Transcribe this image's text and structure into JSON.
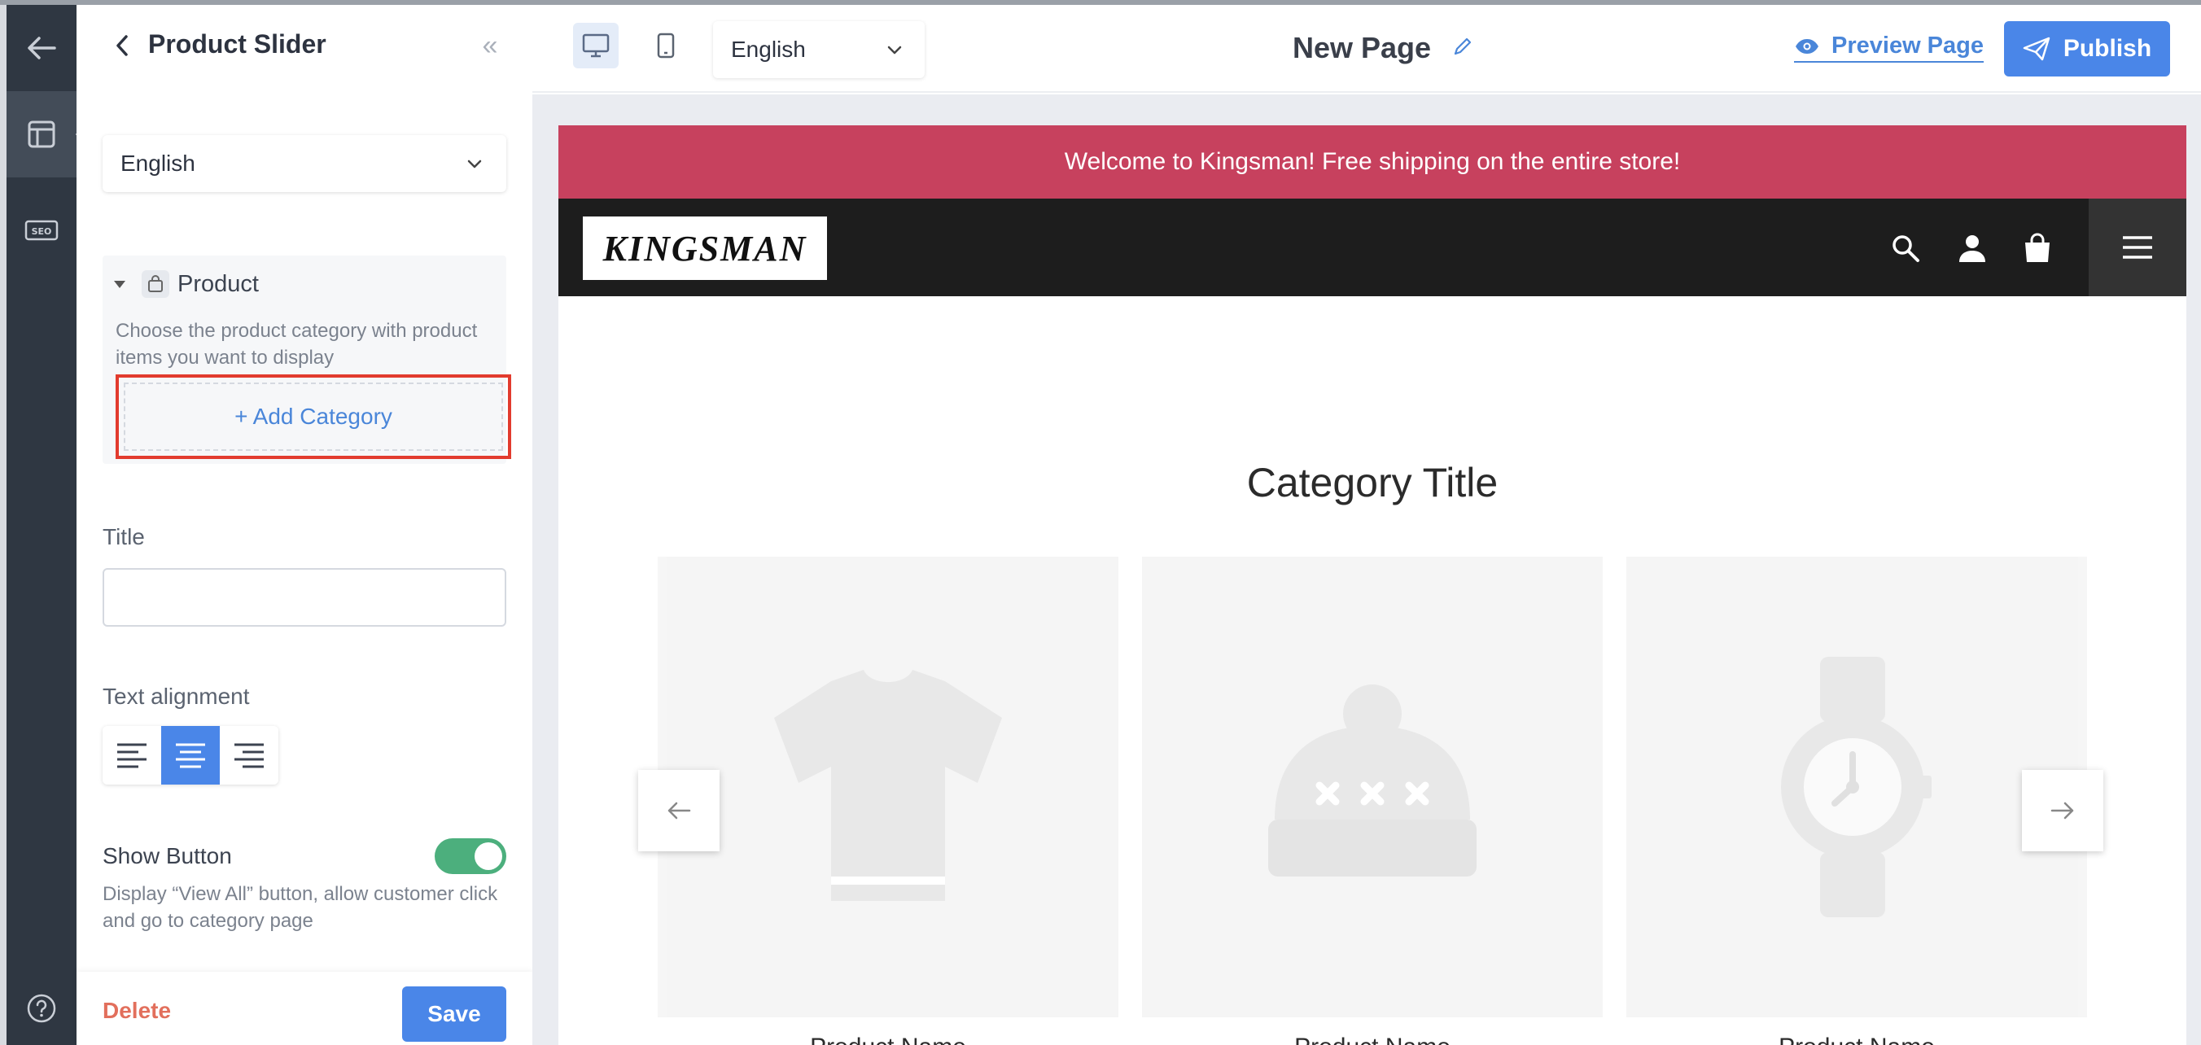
{
  "panel": {
    "title": "Product Slider",
    "language": "English",
    "product_section": {
      "label": "Product",
      "description": "Choose the product category with product items you want to display",
      "add_category": "+ Add Category"
    },
    "title_label": "Title",
    "title_value": "",
    "alignment_label": "Text alignment",
    "alignment_selected": "center",
    "show_button_label": "Show Button",
    "show_button_on": true,
    "show_button_desc": "Display “View All” button, allow customer click and go to category page",
    "delete_label": "Delete",
    "save_label": "Save"
  },
  "topbar": {
    "language": "English",
    "page_name": "New Page",
    "preview_label": "Preview Page",
    "publish_label": "Publish",
    "active_device": "desktop"
  },
  "site": {
    "announcement": "Welcome to Kingsman! Free shipping on the entire store!",
    "logo": "KINGSMAN",
    "category_title": "Category Title",
    "products": [
      {
        "name": "Product Name",
        "icon": "tshirt-icon"
      },
      {
        "name": "Product Name",
        "icon": "beanie-icon"
      },
      {
        "name": "Product Name",
        "icon": "watch-icon"
      }
    ]
  },
  "colors": {
    "accent": "#4a86e8",
    "announcement_bg": "#c7415e",
    "header_bg": "#1d1d1d",
    "toggle_on": "#4caf7d",
    "highlight_border": "#e23b2e",
    "delete": "#e26f5c"
  }
}
